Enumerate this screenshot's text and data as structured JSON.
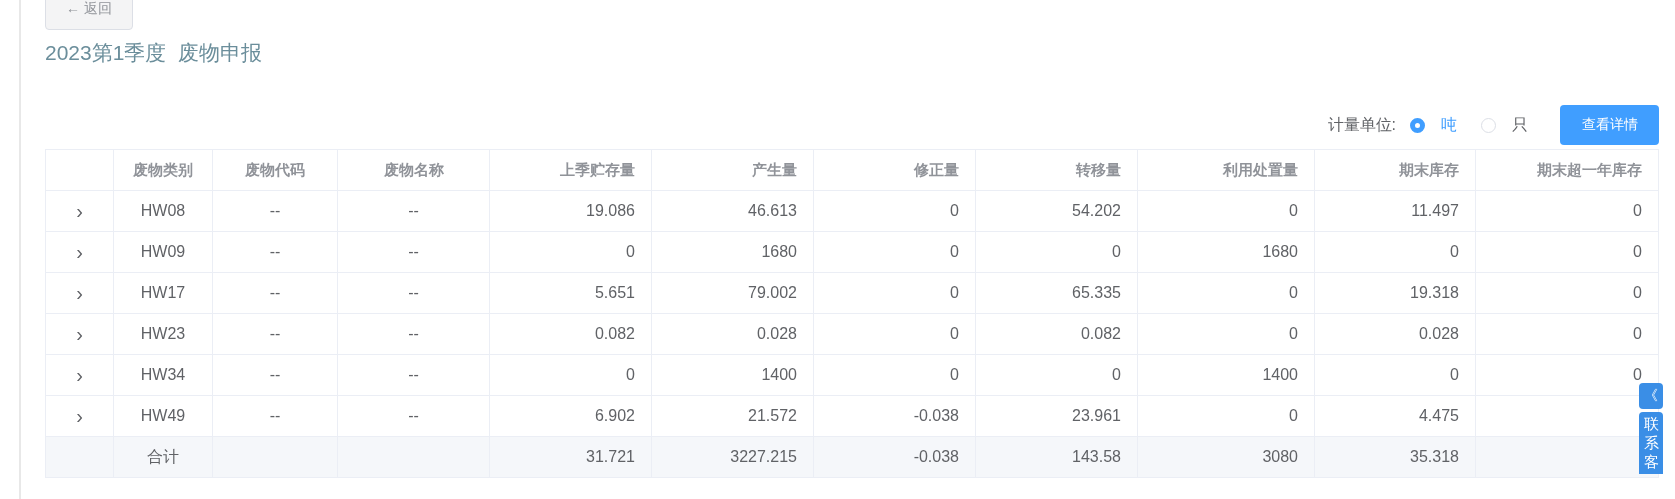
{
  "back_button": {
    "label": "← 返回"
  },
  "title": "2023第1季度  废物申报",
  "unit": {
    "label": "计量单位:",
    "options": [
      {
        "label": "吨",
        "selected": true
      },
      {
        "label": "只",
        "selected": false
      }
    ]
  },
  "detail_button": "查看详情",
  "table": {
    "columns": [
      "废物类别",
      "废物代码",
      "废物名称",
      "上季贮存量",
      "产生量",
      "修正量",
      "转移量",
      "利用处置量",
      "期末库存",
      "期末超一年库存"
    ],
    "rows": [
      {
        "expand": "›",
        "cells": [
          "HW08",
          "--",
          "--",
          "19.086",
          "46.613",
          "0",
          "54.202",
          "0",
          "11.497",
          "0"
        ]
      },
      {
        "expand": "›",
        "cells": [
          "HW09",
          "--",
          "--",
          "0",
          "1680",
          "0",
          "0",
          "1680",
          "0",
          "0"
        ]
      },
      {
        "expand": "›",
        "cells": [
          "HW17",
          "--",
          "--",
          "5.651",
          "79.002",
          "0",
          "65.335",
          "0",
          "19.318",
          "0"
        ]
      },
      {
        "expand": "›",
        "cells": [
          "HW23",
          "--",
          "--",
          "0.082",
          "0.028",
          "0",
          "0.082",
          "0",
          "0.028",
          "0"
        ]
      },
      {
        "expand": "›",
        "cells": [
          "HW34",
          "--",
          "--",
          "0",
          "1400",
          "0",
          "0",
          "1400",
          "0",
          "0"
        ]
      },
      {
        "expand": "›",
        "cells": [
          "HW49",
          "--",
          "--",
          "6.902",
          "21.572",
          "-0.038",
          "23.961",
          "0",
          "4.475",
          ""
        ]
      }
    ],
    "total": {
      "cells": [
        "合计",
        "",
        "",
        "31.721",
        "3227.215",
        "-0.038",
        "143.58",
        "3080",
        "35.318",
        ""
      ]
    }
  },
  "contact_widget": {
    "collapse": "《",
    "label": "联系客"
  }
}
